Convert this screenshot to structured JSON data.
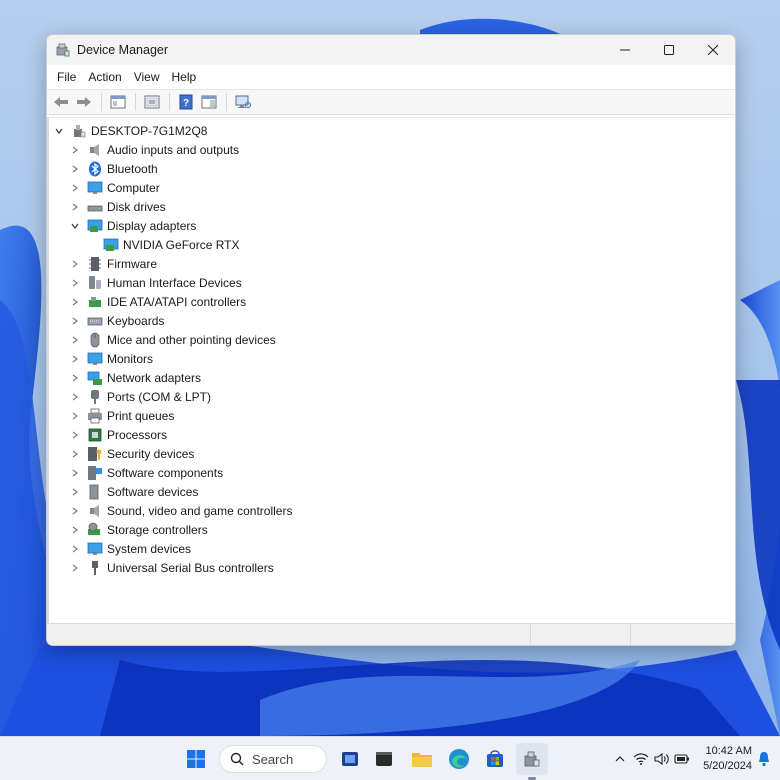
{
  "window": {
    "title": "Device Manager",
    "controls": {
      "minimize": "minimize-icon",
      "maximize": "maximize-icon",
      "close": "close-icon"
    }
  },
  "menu": [
    "File",
    "Action",
    "View",
    "Help"
  ],
  "toolbar": {
    "icons": [
      "back-arrow-icon",
      "forward-arrow-icon",
      "show-hide-console-tree-icon",
      "properties-icon",
      "help-icon",
      "action-pane-icon",
      "scan-hardware-icon"
    ]
  },
  "tree": {
    "root": {
      "label": "DESKTOP-7G1M2Q8",
      "icon": "computer-tower-icon",
      "expanded": true
    },
    "categories": [
      {
        "label": "Audio inputs and outputs",
        "icon": "speaker-icon",
        "expanded": false
      },
      {
        "label": "Bluetooth",
        "icon": "bluetooth-icon",
        "expanded": false
      },
      {
        "label": "Computer",
        "icon": "monitor-icon",
        "expanded": false
      },
      {
        "label": "Disk drives",
        "icon": "disk-drive-icon",
        "expanded": false
      },
      {
        "label": "Display adapters",
        "icon": "display-adapter-icon",
        "expanded": true,
        "children": [
          {
            "label": "NVIDIA GeForce RTX",
            "icon": "display-adapter-icon"
          }
        ]
      },
      {
        "label": "Firmware",
        "icon": "firmware-icon",
        "expanded": false
      },
      {
        "label": "Human Interface Devices",
        "icon": "hid-icon",
        "expanded": false
      },
      {
        "label": "IDE ATA/ATAPI controllers",
        "icon": "ide-controller-icon",
        "expanded": false
      },
      {
        "label": "Keyboards",
        "icon": "keyboard-icon",
        "expanded": false
      },
      {
        "label": "Mice and other pointing devices",
        "icon": "mouse-icon",
        "expanded": false
      },
      {
        "label": "Monitors",
        "icon": "monitor-icon",
        "expanded": false
      },
      {
        "label": "Network adapters",
        "icon": "network-adapter-icon",
        "expanded": false
      },
      {
        "label": "Ports (COM & LPT)",
        "icon": "port-icon",
        "expanded": false
      },
      {
        "label": "Print queues",
        "icon": "printer-icon",
        "expanded": false
      },
      {
        "label": "Processors",
        "icon": "processor-icon",
        "expanded": false
      },
      {
        "label": "Security devices",
        "icon": "security-device-icon",
        "expanded": false
      },
      {
        "label": "Software components",
        "icon": "software-component-icon",
        "expanded": false
      },
      {
        "label": "Software devices",
        "icon": "software-device-icon",
        "expanded": false
      },
      {
        "label": "Sound, video and game controllers",
        "icon": "speaker-icon",
        "expanded": false
      },
      {
        "label": "Storage controllers",
        "icon": "storage-controller-icon",
        "expanded": false
      },
      {
        "label": "System devices",
        "icon": "system-device-icon",
        "expanded": false
      },
      {
        "label": "Universal Serial Bus controllers",
        "icon": "usb-icon",
        "expanded": false
      }
    ]
  },
  "taskbar": {
    "search_label": "Search",
    "pinned": [
      "start-icon",
      "task-view-icon",
      "terminal-icon",
      "file-explorer-icon",
      "edge-icon",
      "store-icon",
      "device-manager-icon"
    ],
    "tray": [
      "chevron-up-icon",
      "wifi-icon",
      "volume-icon",
      "battery-icon"
    ],
    "time": "10:42 AM",
    "date": "5/20/2024",
    "notification_icon": "bell-icon"
  },
  "colors": {
    "accent": "#0067c0",
    "wallpaper_blue": "#1a4fd6",
    "titlebar": "#f3f3f3"
  }
}
